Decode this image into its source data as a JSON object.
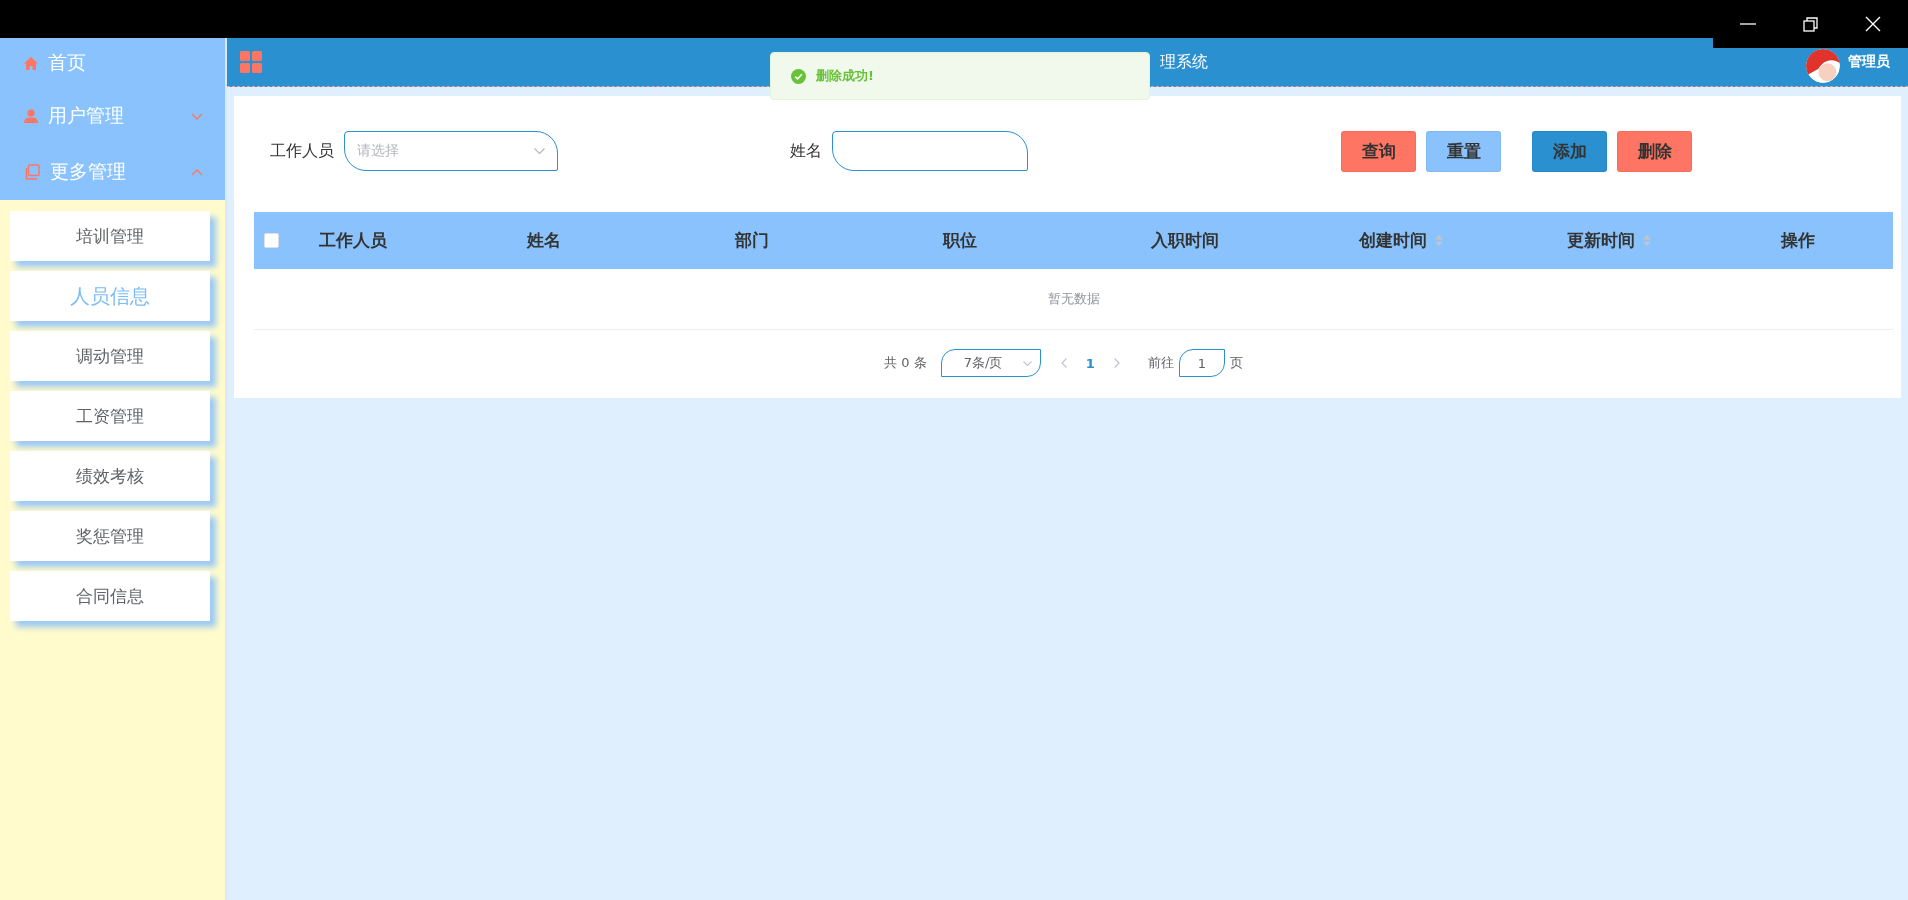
{
  "sidebar": {
    "items": [
      {
        "label": "首页",
        "kind": "link"
      },
      {
        "label": "用户管理",
        "kind": "group",
        "expanded": false
      },
      {
        "label": "更多管理",
        "kind": "group",
        "expanded": true,
        "children": [
          {
            "label": "培训管理",
            "selected": false
          },
          {
            "label": "人员信息",
            "selected": true
          },
          {
            "label": "调动管理",
            "selected": false
          },
          {
            "label": "工资管理",
            "selected": false
          },
          {
            "label": "绩效考核",
            "selected": false
          },
          {
            "label": "奖惩管理",
            "selected": false
          },
          {
            "label": "合同信息",
            "selected": false
          }
        ]
      }
    ]
  },
  "header": {
    "title": "理系统",
    "user": "管理员"
  },
  "toast": {
    "message": "删除成功!"
  },
  "filters": [
    {
      "label": "工作人员",
      "kind": "select",
      "placeholder": "请选择"
    },
    {
      "label": "姓名",
      "kind": "input"
    }
  ],
  "buttons": [
    {
      "label": "查询",
      "color": "#ff7563"
    },
    {
      "label": "重置",
      "color": "#89c2fc"
    },
    {
      "label": "添加",
      "color": "#2a90d0"
    },
    {
      "label": "删除",
      "color": "#ff7563"
    }
  ],
  "table": {
    "select_all": {
      "checked": false
    },
    "columns": [
      {
        "label": "工作人员",
        "sortable": false
      },
      {
        "label": "姓名",
        "sortable": false
      },
      {
        "label": "部门",
        "sortable": false
      },
      {
        "label": "职位",
        "sortable": false
      },
      {
        "label": "入职时间",
        "sortable": false
      },
      {
        "label": "创建时间",
        "sortable": true
      },
      {
        "label": "更新时间",
        "sortable": true
      },
      {
        "label": "操作",
        "sortable": false
      }
    ],
    "empty_text": "暂无数据"
  },
  "pagination": {
    "total": "共 0 条",
    "page_size": "7条/页",
    "pages": [
      {
        "label": "1",
        "selected": true
      }
    ],
    "goto_label": "前往",
    "goto_value": "1",
    "goto_suffix": "页"
  }
}
